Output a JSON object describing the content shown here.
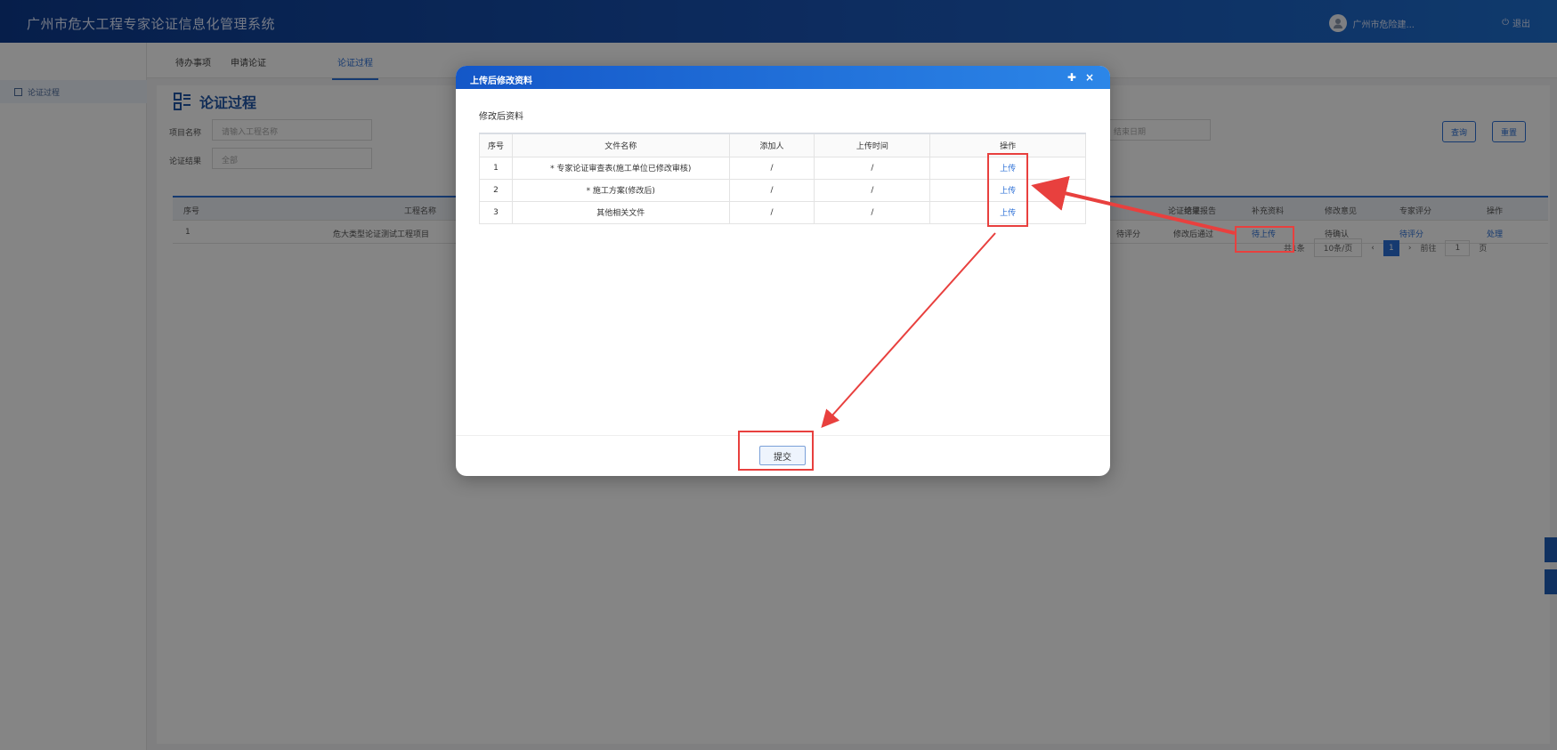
{
  "header": {
    "title": "广州市危大工程专家论证信息化管理系统",
    "user_name": "广州市危险建...",
    "logout_label": "退出"
  },
  "sidebar": {
    "items": [
      {
        "label": "论证过程"
      }
    ]
  },
  "subtabs": [
    {
      "label": "待办事项"
    },
    {
      "label": "申请论证"
    },
    {
      "label": "论证过程"
    }
  ],
  "page": {
    "title": "论证过程",
    "filters": {
      "project_label": "项目名称",
      "project_placeholder": "请输入工程名称",
      "result_label": "论证结果",
      "result_placeholder": "全部",
      "date_placeholder": "结束日期",
      "search_label": "查询",
      "reset_label": "重置"
    },
    "table": {
      "headers": [
        "序号",
        "工程名称",
        "论证结果",
        "论证报告",
        "补充资料",
        "修改意见",
        "专家评分",
        "操作"
      ],
      "row": {
        "index": "1",
        "name": "危大类型论证测试工程项目",
        "col_a": "待评分",
        "result": "修改后通过",
        "supplement": "待上传",
        "opinion": "待确认",
        "score": "待评分",
        "action": "处理"
      }
    },
    "pager": {
      "total": "共1条",
      "page_size": "10条/页",
      "current": "1",
      "goto_label": "前往",
      "goto_value": "1",
      "page_unit": "页"
    }
  },
  "modal": {
    "title": "上传后修改资料",
    "section_title": "修改后资料",
    "headers": [
      "序号",
      "文件名称",
      "添加人",
      "上传时间",
      "操作"
    ],
    "rows": [
      {
        "index": "1",
        "name": "* 专家论证审查表(施工单位已修改审核)",
        "adder": "/",
        "time": "/",
        "action": "上传"
      },
      {
        "index": "2",
        "name": "* 施工方案(修改后)",
        "adder": "/",
        "time": "/",
        "action": "上传"
      },
      {
        "index": "3",
        "name": "其他相关文件",
        "adder": "/",
        "time": "/",
        "action": "上传"
      }
    ],
    "submit_label": "提交",
    "tool_icons": [
      "expand-icon",
      "close-icon"
    ]
  },
  "colors": {
    "brand": "#1a56b8",
    "accent": "#2b6fd6",
    "highlight": "#e8403e"
  }
}
